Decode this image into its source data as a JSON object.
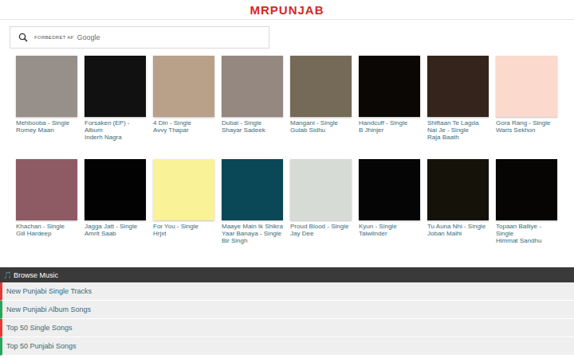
{
  "logo": "MRPUNJAB",
  "search": {
    "label": "FORBEDRET AF",
    "brand": "Google"
  },
  "albums": [
    {
      "title": "Mehbooba - Single",
      "artist": "Romey Maan",
      "color": "#978f8a"
    },
    {
      "title": "Forsaken (EP) - Album",
      "artist": "Inderh Nagra",
      "color": "#111111"
    },
    {
      "title": "4 Din - Single",
      "artist": "Avvy Thapar",
      "color": "#b9a089"
    },
    {
      "title": "Dubai - Single",
      "artist": "Shayar Sadeek",
      "color": "#958880"
    },
    {
      "title": "Mangani - Single",
      "artist": "Gulab Sidhu",
      "color": "#756a57"
    },
    {
      "title": "Handcuff - Single",
      "artist": "B Jhinjer",
      "color": "#0a0705"
    },
    {
      "title": "Shiftaan Te Lagda Nai Je - Single",
      "artist": "Raja Baath",
      "color": "#34241c"
    },
    {
      "title": "Gora Rang - Single",
      "artist": "Waris Sekhon",
      "color": "#fbd9cc"
    },
    {
      "title": "Khachan - Single",
      "artist": "Gill Hardeep",
      "color": "#8e5a64"
    },
    {
      "title": "Jagga Jatt - Single",
      "artist": "Amrit Saab",
      "color": "#020202"
    },
    {
      "title": "For You - Single",
      "artist": "Hrjxt",
      "color": "#f9f296"
    },
    {
      "title": "Maaye Main Ik Shikra Yaar Banaya - Single",
      "artist": "Bir Singh",
      "color": "#0a4858"
    },
    {
      "title": "Proud Blood - Single",
      "artist": "Jay Dee",
      "color": "#d7dbd6"
    },
    {
      "title": "Kyun - Single",
      "artist": "Talwiinder",
      "color": "#050505"
    },
    {
      "title": "Tu Auna Nhi - Single",
      "artist": "Joban Malhi",
      "color": "#15120a"
    },
    {
      "title": "Topaan Balliye - Single",
      "artist": "Himmat Sandhu",
      "color": "#060503"
    }
  ],
  "browse": {
    "icon": "🎵",
    "title": "Browse Music"
  },
  "links": [
    {
      "label": "New Punjabi Single Tracks",
      "color": "#e53935"
    },
    {
      "label": "New Punjabi Album Songs",
      "color": "#26a65b"
    },
    {
      "label": "Top 50 Single Songs",
      "color": "#e53935"
    },
    {
      "label": "Top 50 Punjabi Songs",
      "color": "#26a65b"
    }
  ]
}
